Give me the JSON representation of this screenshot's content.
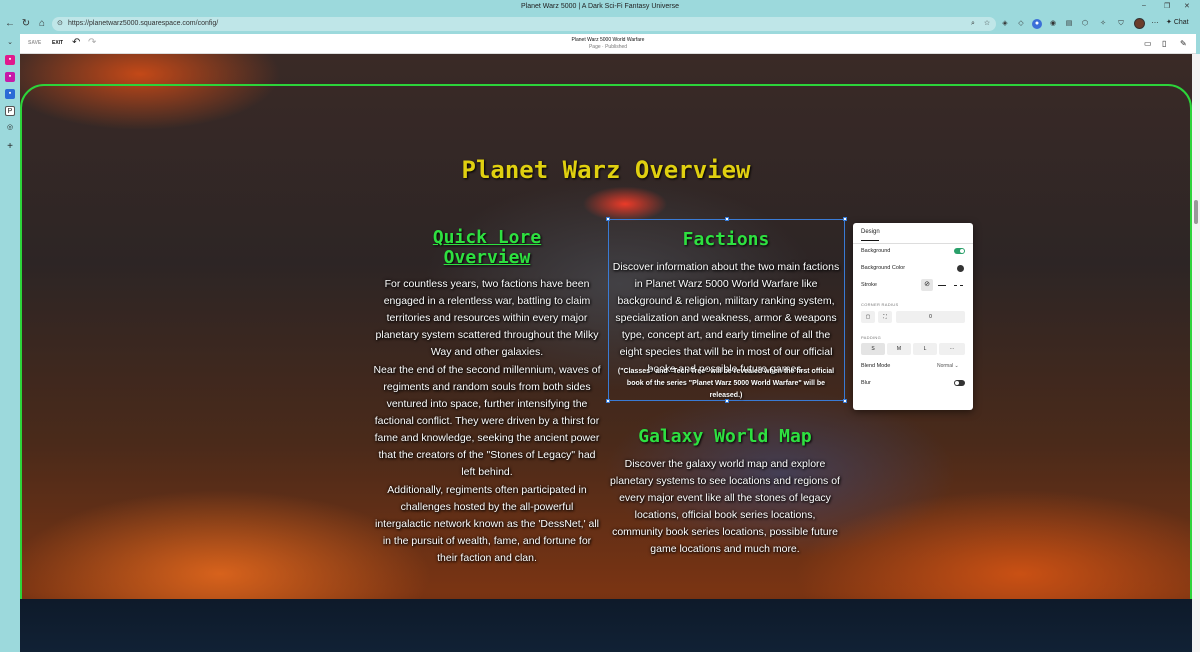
{
  "window": {
    "title": "Planet Warz 5000 | A Dark Sci-Fi Fantasy Universe",
    "minimize": "–",
    "restore": "❐",
    "close": "✕"
  },
  "browser": {
    "url": "https://planetwarz5000.squarespace.com/config/",
    "chat_label": "Chat"
  },
  "editor": {
    "save_label": "SAVE",
    "exit_label": "EXIT",
    "page_title": "Planet Warz 5000 World Warfare",
    "page_status": "Page · Published"
  },
  "page": {
    "heading": "Planet Warz Overview",
    "lore": {
      "title": "Quick Lore Overview",
      "p1": "For countless years, two factions have been engaged in a relentless war, battling to claim territories and resources within every major planetary system scattered throughout the Milky Way and other galaxies.",
      "p2": "Near the end of the second millennium, waves of regiments and random souls from both sides ventured into space, further intensifying the factional conflict. They were driven by a thirst for fame and knowledge, seeking the ancient power that the creators of the \"Stones of Legacy\" had left behind.",
      "p3": "Additionally, regiments often participated in challenges hosted by the all-powerful intergalactic network known as the 'DessNet,' all in the pursuit of wealth, fame, and fortune for their faction and clan."
    },
    "factions": {
      "title": "Factions",
      "text": "Discover information about the two main factions in Planet Warz 5000 World Warfare like background & religion, military ranking system, specialization and weakness, armor & weapons type, concept art, and early timeline of all the eight species that will be in most of our official books and possible future games.",
      "note": "(\"Classes\" and \"Tech Tree\" will be revealed when the first official book of the series \"Planet Warz 5000 World Warfare\" will be released.)"
    },
    "map": {
      "title": "Galaxy World Map",
      "text": "Discover the galaxy world map and explore planetary systems to see locations and regions of every major event like all the stones of legacy locations, official book series locations, community book series locations, possible future game locations and much more."
    }
  },
  "design_panel": {
    "tab": "Design",
    "background_label": "Background",
    "background_enabled": true,
    "background_color_label": "Background Color",
    "background_color": "#333333",
    "stroke_label": "Stroke",
    "corner_radius_caption": "CORNER RADIUS",
    "corner_radius_value": "0",
    "padding_caption": "PADDING",
    "padding_options": [
      "S",
      "M",
      "L",
      "···"
    ],
    "blend_mode_label": "Blend Mode",
    "blend_mode_value": "Normal",
    "blur_label": "Blur",
    "blur_enabled": false
  },
  "colors": {
    "heading": "#e0d010",
    "section_titles": "#2ee040",
    "frame": "#2cd43a",
    "selection": "#3a7bd5"
  }
}
